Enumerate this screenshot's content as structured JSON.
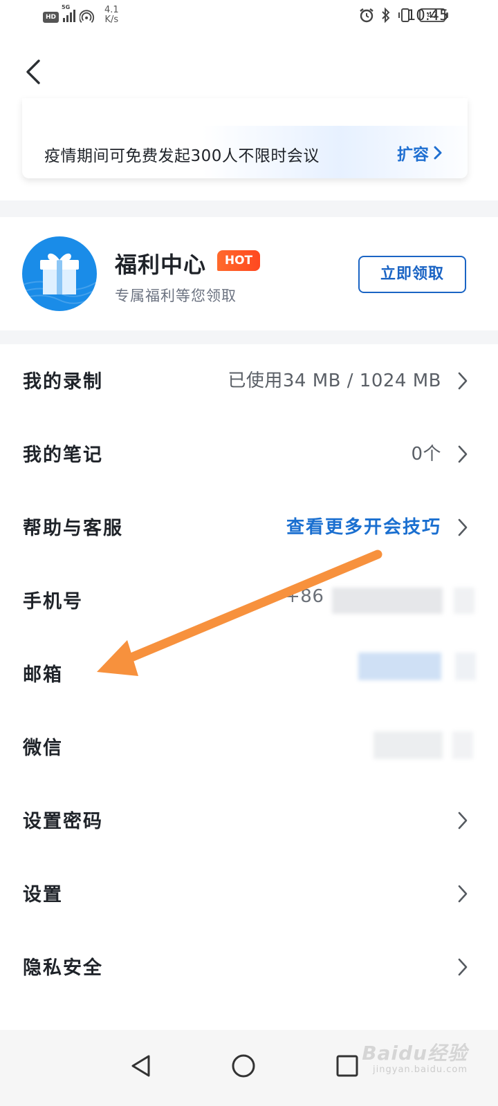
{
  "status_bar": {
    "hd": "HD",
    "network": "5G",
    "speed_value": "4.1",
    "speed_unit": "K/s",
    "battery": "47",
    "time": "10:45"
  },
  "capacity_card": {
    "text": "疫情期间可免费发起300人不限时会议",
    "link": "扩容"
  },
  "welfare": {
    "title": "福利中心",
    "badge": "HOT",
    "subtitle": "专属福利等您领取",
    "button": "立即领取"
  },
  "list": [
    {
      "label": "我的录制",
      "value": "已使用34 MB / 1024 MB"
    },
    {
      "label": "我的笔记",
      "value": "0个"
    },
    {
      "label": "帮助与客服",
      "value": "查看更多开会技巧"
    },
    {
      "label": "手机号",
      "value": "+86"
    },
    {
      "label": "邮箱",
      "value": ""
    },
    {
      "label": "微信",
      "value": ""
    },
    {
      "label": "设置密码",
      "value": ""
    },
    {
      "label": "设置",
      "value": ""
    },
    {
      "label": "隐私安全",
      "value": ""
    }
  ],
  "watermark": {
    "logo": "Baidu经验",
    "url": "jingyan.baidu.com"
  },
  "colors": {
    "accent_blue": "#1a6fd0",
    "hot_orange": "#ff5a26",
    "annotation_arrow": "#f7913d"
  }
}
